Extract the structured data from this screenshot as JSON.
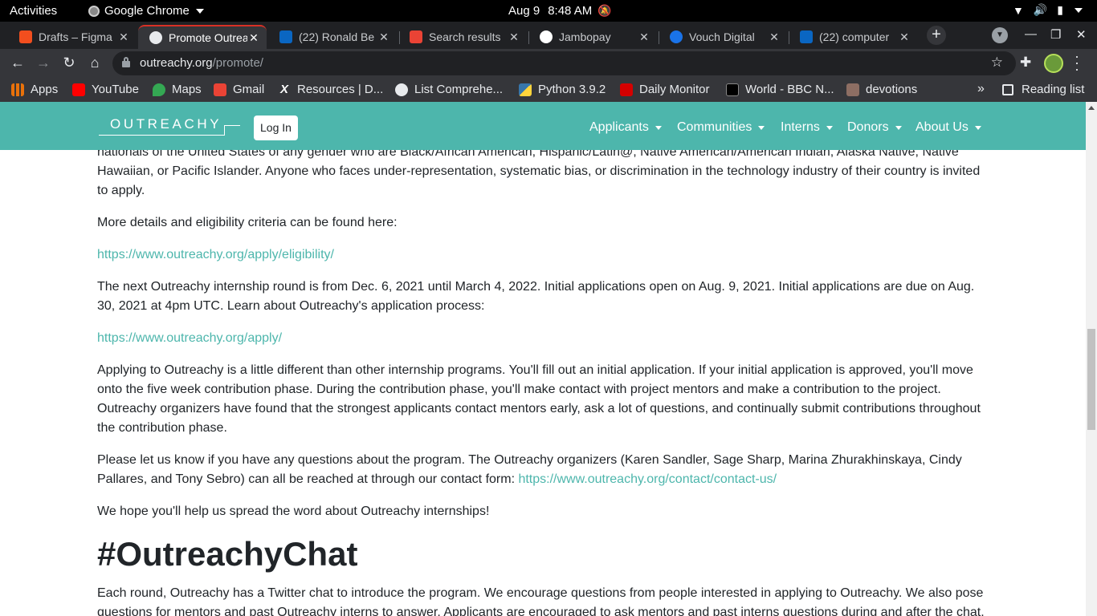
{
  "system_bar": {
    "activities": "Activities",
    "app_name": "Google Chrome",
    "date": "Aug 9",
    "time": "8:48 AM"
  },
  "tabs": [
    {
      "title": "Drafts – Figma",
      "favicon": "figma-icon",
      "color": "#f24e1e",
      "active": false
    },
    {
      "title": "Promote Outreachy",
      "favicon": "globe-icon",
      "color": "#e8eaed",
      "active": true
    },
    {
      "title": "(22) Ronald Be",
      "favicon": "linkedin-icon",
      "color": "#0a66c2",
      "active": false
    },
    {
      "title": "Search results",
      "favicon": "gmail-icon",
      "color": "#ea4335",
      "active": false
    },
    {
      "title": "Jambopay",
      "favicon": "jambopay-icon",
      "color": "#ffffff",
      "active": false
    },
    {
      "title": "Vouch Digital",
      "favicon": "vouch-icon",
      "color": "#1a73e8",
      "active": false
    },
    {
      "title": "(22) computer",
      "favicon": "linkedin-icon",
      "color": "#0a66c2",
      "active": false
    }
  ],
  "toolbar": {
    "url_host": "outreachy.org",
    "url_path": "/promote/"
  },
  "bookmarks": [
    {
      "label": "Apps",
      "icon": "apps-grid-icon",
      "color": "#e8710a"
    },
    {
      "label": "YouTube",
      "icon": "youtube-icon",
      "color": "#ff0000"
    },
    {
      "label": "Maps",
      "icon": "maps-icon",
      "color": "#34a853"
    },
    {
      "label": "Gmail",
      "icon": "gmail-icon",
      "color": "#ea4335"
    },
    {
      "label": "Resources | D...",
      "icon": "x-icon",
      "color": "#ffffff"
    },
    {
      "label": "List Comprehe...",
      "icon": "globe-icon",
      "color": "#e8eaed"
    },
    {
      "label": "Python 3.9.2",
      "icon": "python-icon",
      "color": "#ffd43b"
    },
    {
      "label": "Daily Monitor",
      "icon": "daily-monitor-icon",
      "color": "#d50000"
    },
    {
      "label": "World - BBC N...",
      "icon": "bbc-icon",
      "color": "#000000"
    },
    {
      "label": "devotions",
      "icon": "devotions-icon",
      "color": "#8d6e63"
    }
  ],
  "reading_list": "Reading list",
  "site": {
    "logo_text": "OUTREACHY",
    "login": "Log In",
    "nav": [
      "Applicants",
      "Communities",
      "Interns",
      "Donors",
      "About Us"
    ],
    "brand_color": "#4db6ac"
  },
  "content": {
    "p1": "nationals of the United States of any gender who are Black/African American, Hispanic/Latin@, Native American/American Indian, Alaska Native, Native Hawaiian, or Pacific Islander. Anyone who faces under-representation, systematic bias, or discrimination in the technology industry of their country is invited to apply.",
    "p2": "More details and eligibility criteria can be found here:",
    "link1": "https://www.outreachy.org/apply/eligibility/",
    "p3": "The next Outreachy internship round is from Dec. 6, 2021 until March 4, 2022. Initial applications open on Aug. 9, 2021. Initial applications are due on Aug. 30, 2021 at 4pm UTC. Learn about Outreachy's application process:",
    "link2": "https://www.outreachy.org/apply/",
    "p4": "Applying to Outreachy is a little different than other internship programs. You'll fill out an initial application. If your initial application is approved, you'll move onto the five week contribution phase. During the contribution phase, you'll make contact with project mentors and make a contribution to the project. Outreachy organizers have found that the strongest applicants contact mentors early, ask a lot of questions, and continually submit contributions throughout the contribution phase.",
    "p5": "Please let us know if you have any questions about the program. The Outreachy organizers (Karen Sandler, Sage Sharp, Marina Zhurakhinskaya, Cindy Pallares, and Tony Sebro) can all be reached at through our contact form: ",
    "link3": "https://www.outreachy.org/contact/contact-us/",
    "p6": "We hope you'll help us spread the word about Outreachy internships!",
    "h1": "#OutreachyChat",
    "p7": "Each round, Outreachy has a Twitter chat to introduce the program. We encourage questions from people interested in applying to Outreachy. We also pose questions for mentors and past Outreachy interns to answer. Applicants are encouraged to ask mentors and past interns questions during and after the chat."
  }
}
